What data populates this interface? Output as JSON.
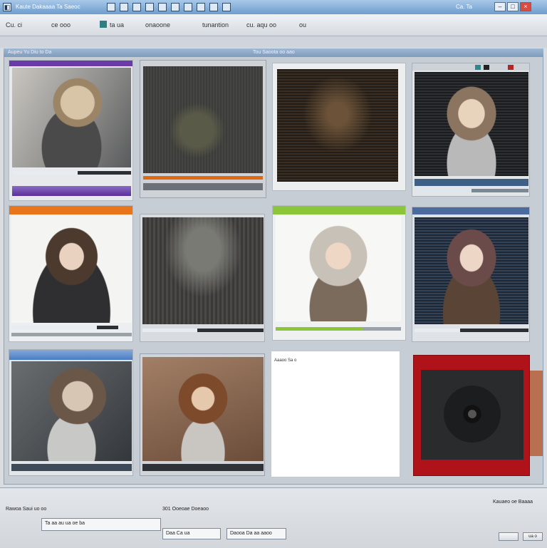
{
  "window": {
    "title": "Kaute Dakaaaa Ta Saeoc",
    "title_right": "Ca. Ta",
    "controls": [
      "–",
      "□",
      "×"
    ]
  },
  "toolbar": {
    "items": [
      "Cu. ci",
      "ce ooo",
      "ta ua",
      "onaoone",
      "tunantion",
      "cu. aqu oo",
      "ou"
    ]
  },
  "panel": {
    "header_left": "Aupeu Yu Diu to Da",
    "header_right": "Tou Saoota oo aao"
  },
  "tiles": [
    {
      "id": "t1",
      "caption": "",
      "accent": "#6a3aa8",
      "progress": 0.55
    },
    {
      "id": "t2",
      "caption": "",
      "accent": "#e06a12",
      "progress": 0.95
    },
    {
      "id": "t3",
      "caption": "",
      "accent": "#8e8e8e",
      "progress": 0.0
    },
    {
      "id": "t4",
      "caption": "",
      "accent": "#6a7f96",
      "progress": 0.5
    },
    {
      "id": "t5",
      "caption": "",
      "accent": "#e8741c",
      "progress": 0.8
    },
    {
      "id": "t6",
      "caption": "",
      "accent": "#a8aeb4",
      "progress": 0.45
    },
    {
      "id": "t7",
      "caption": "",
      "accent": "#8cc43a",
      "progress": 0.7
    },
    {
      "id": "t8",
      "caption": "",
      "accent": "#4b6aa0",
      "progress": 0.4
    },
    {
      "id": "t9",
      "caption": "",
      "accent": "#4a7cc4",
      "progress": 0.0
    },
    {
      "id": "t10",
      "caption": "",
      "accent": "#6b5a4a",
      "progress": 0.0
    },
    {
      "id": "t11",
      "caption": "Aaaoo Sa o",
      "accent": "#ffffff",
      "progress": 0.0
    },
    {
      "id": "t12",
      "caption": "",
      "accent": "#b0121a",
      "progress": 0.0
    }
  ],
  "bottom": {
    "left_label": "Rawoa Saui uo oo",
    "mid_label": "301 Ooeoae Doeaoo",
    "right_label": "Kauaeo oe Baaaa",
    "field1": "Ta aa au ua oe ba",
    "field2": "Daa Ca ua",
    "field3": "Daooa Da aa aaoo",
    "buttons": [
      "",
      "ua o"
    ]
  },
  "colors": {
    "titlebar": "#7ea6d0",
    "panel_border": "#8ea2b8",
    "accent_red": "#b0121a"
  },
  "icons": [
    "app-icon",
    "toolbar-icon",
    "minimize-icon",
    "maximize-icon",
    "close-icon",
    "disc-icon"
  ]
}
